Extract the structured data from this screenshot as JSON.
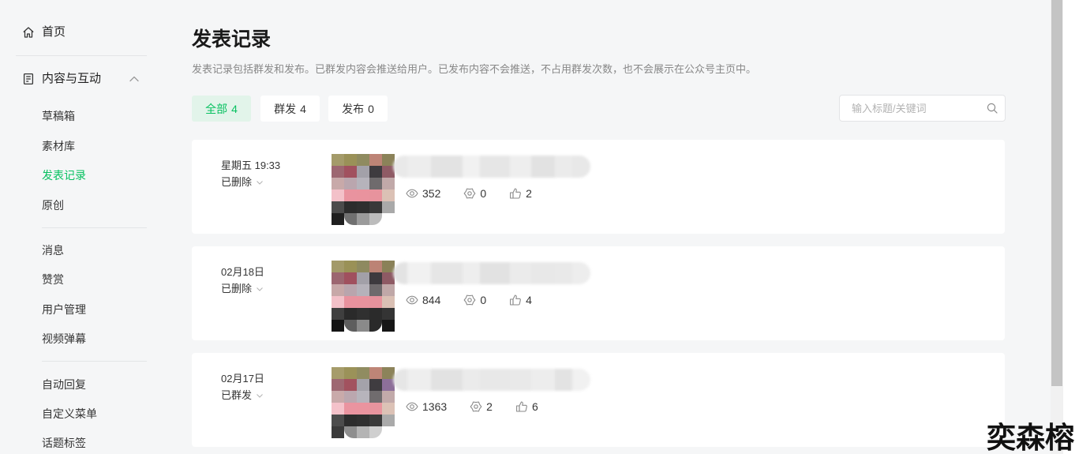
{
  "colors": {
    "accent": "#07c160",
    "accent_bg": "#e2f4ea"
  },
  "sidebar": {
    "home": {
      "label": "首页",
      "icon": "home-icon"
    },
    "content_group": {
      "label": "内容与互动",
      "icon": "document-icon",
      "expanded": true
    },
    "content_items": [
      {
        "label": "草稿箱",
        "active": false
      },
      {
        "label": "素材库",
        "active": false
      },
      {
        "label": "发表记录",
        "active": true
      },
      {
        "label": "原创",
        "active": false
      }
    ],
    "interaction_items": [
      {
        "label": "消息"
      },
      {
        "label": "赞赏"
      },
      {
        "label": "用户管理"
      },
      {
        "label": "视频弹幕"
      }
    ],
    "feature_items": [
      {
        "label": "自动回复"
      },
      {
        "label": "自定义菜单"
      },
      {
        "label": "话题标签"
      }
    ]
  },
  "header": {
    "title": "发表记录",
    "description": "发表记录包括群发和发布。已群发内容会推送给用户。已发布内容不会推送，不占用群发次数，也不会展示在公众号主页中。"
  },
  "filters": {
    "tabs": [
      {
        "label": "全部",
        "count": 4,
        "active": true
      },
      {
        "label": "群发",
        "count": 4,
        "active": false
      },
      {
        "label": "发布",
        "count": 0,
        "active": false
      }
    ],
    "search": {
      "placeholder": "输入标题/关键词",
      "value": ""
    }
  },
  "records": [
    {
      "date": "星期五 19:33",
      "status": "已删除",
      "stats": {
        "reads": 352,
        "wows": 0,
        "likes": 2
      }
    },
    {
      "date": "02月18日",
      "status": "已删除",
      "stats": {
        "reads": 844,
        "wows": 0,
        "likes": 4
      }
    },
    {
      "date": "02月17日",
      "status": "已群发",
      "stats": {
        "reads": 1363,
        "wows": 2,
        "likes": 6
      }
    }
  ],
  "stat_icons": {
    "reads": "eye-icon",
    "wows": "gear-icon",
    "likes": "thumbs-up-icon"
  },
  "scroll": {
    "progress": 0,
    "visible_fraction": 0.85
  },
  "watermark": "奕森榕"
}
